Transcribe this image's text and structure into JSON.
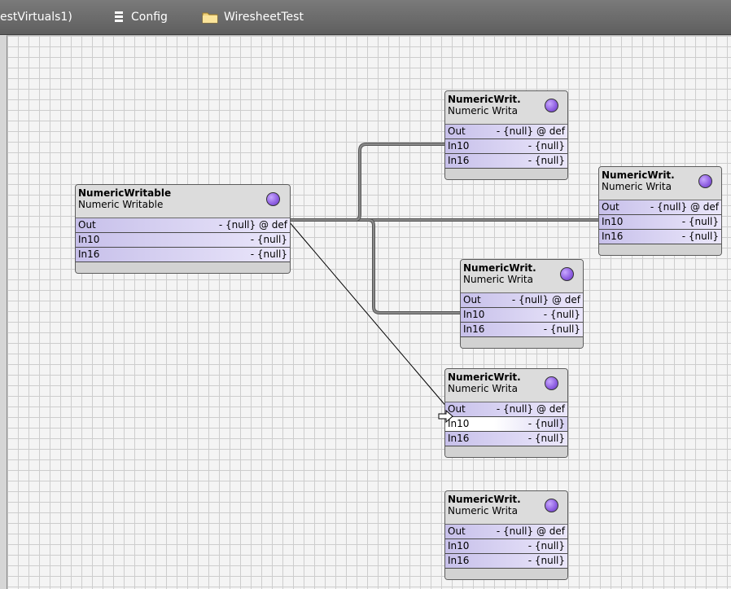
{
  "breadcrumb": {
    "station": "estVirtuals1)",
    "config": "Config",
    "folder": "WiresheetTest"
  },
  "colors": {
    "wire": "#6b6b6b",
    "slot_purple": "#c7c0ea",
    "dot": "#8c5ce0"
  },
  "nodes": [
    {
      "name": "NumericWritable",
      "type": "Numeric Writable",
      "slots": [
        {
          "name": "Out",
          "value": "- {null} @ def"
        },
        {
          "name": "In10",
          "value": "- {null}"
        },
        {
          "name": "In16",
          "value": "- {null}"
        }
      ]
    },
    {
      "name": "NumericWrit.",
      "type": "Numeric Writa",
      "slots": [
        {
          "name": "Out",
          "value": "- {null} @ def"
        },
        {
          "name": "In10",
          "value": "- {null}"
        },
        {
          "name": "In16",
          "value": "- {null}"
        }
      ]
    },
    {
      "name": "NumericWrit.",
      "type": "Numeric Writa",
      "slots": [
        {
          "name": "Out",
          "value": "- {null} @ def"
        },
        {
          "name": "In10",
          "value": "- {null}"
        },
        {
          "name": "In16",
          "value": "- {null}"
        }
      ]
    },
    {
      "name": "NumericWrit.",
      "type": "Numeric Writa",
      "slots": [
        {
          "name": "Out",
          "value": "- {null} @ def"
        },
        {
          "name": "In10",
          "value": "- {null}"
        },
        {
          "name": "In16",
          "value": "- {null}"
        }
      ]
    },
    {
      "name": "NumericWrit.",
      "type": "Numeric Writa",
      "slots": [
        {
          "name": "Out",
          "value": "- {null} @ def"
        },
        {
          "name": "In10",
          "value": "- {null}"
        },
        {
          "name": "In16",
          "value": "- {null}"
        }
      ]
    },
    {
      "name": "NumericWrit.",
      "type": "Numeric Writa",
      "slots": [
        {
          "name": "Out",
          "value": "- {null} @ def"
        },
        {
          "name": "In10",
          "value": "- {null}"
        },
        {
          "name": "In16",
          "value": "- {null}"
        }
      ]
    }
  ]
}
